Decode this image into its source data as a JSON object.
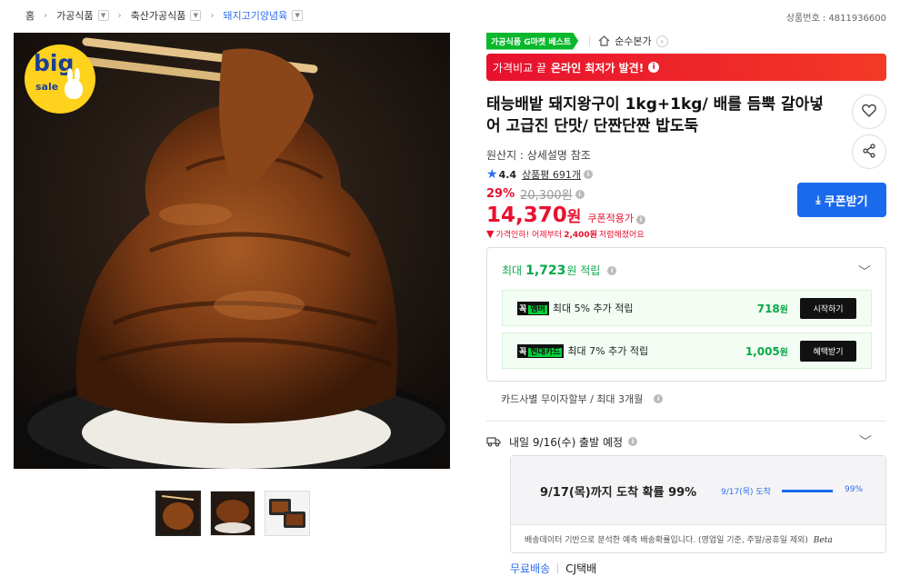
{
  "breadcrumb": [
    {
      "label": "홈",
      "dropdown": false
    },
    {
      "label": "가공식품",
      "dropdown": true
    },
    {
      "label": "축산가공식품",
      "dropdown": true
    },
    {
      "label": "돼지고기양념육",
      "dropdown": true
    }
  ],
  "product_number": "상품번호 : 4811936600",
  "image_badge": {
    "big": "big",
    "sale": "sale"
  },
  "thumbnails": [
    "thumbnail-1",
    "thumbnail-2",
    "thumbnail-3"
  ],
  "best_badge": "가공식품 G마켓 베스트",
  "store_name": "순수본가",
  "price_banner": {
    "prefix": "가격비교 끝",
    "highlight": "온라인 최저가 발견!"
  },
  "title": "태능배밭 돼지왕구이 1kg+1kg/ 배를 듬뿍 갈아넣어 고급진 단맛/ 단짠단짠 밥도둑",
  "origin": "원산지 : 상세설명 참조",
  "rating": {
    "score": "4.4",
    "reviews": "상품평 691개"
  },
  "price": {
    "discount": "29%",
    "original": "20,300원",
    "sale_number": "14,370",
    "sale_unit": "원",
    "coupon_applied": "쿠폰적용가",
    "drop_prefix": "가격인하! 어제부터",
    "drop_amount": "2,400원",
    "drop_suffix": "저렴해졌어요"
  },
  "coupon_button": "쿠폰받기",
  "points": {
    "prefix": "최대",
    "amount": "1,723",
    "suffix": "원 적립",
    "promos": [
      {
        "logo_a": "꼭",
        "logo_b": "멤버",
        "desc": "최대 5% 추가 적립",
        "amount": "718",
        "unit": "원",
        "button": "시작하기"
      },
      {
        "logo_a": "꼭",
        "logo_b": "현대카드",
        "desc": "최대 7% 추가 적립",
        "amount": "1,005",
        "unit": "원",
        "button": "혜택받기"
      }
    ]
  },
  "installment": "카드사별 무이자할부 / 최대 3개월",
  "shipping": {
    "text": "내일 9/16(수) 출발 예정",
    "probability_main": "9/17(목)까지 도착 확률 99%",
    "probability_date": "9/17(목) 도착",
    "probability_value": 0.99,
    "probability_pct": "99%",
    "note": "배송데이터 기반으로 분석한 예측 배송확률입니다. (영업일 기준, 주말/공휴일 제외)",
    "beta": "Beta",
    "free_shipping": "무료배송",
    "carrier": "CJ택배"
  },
  "colors": {
    "accent": "#e8102e",
    "blue": "#1a6aed",
    "green": "#09a84a"
  }
}
